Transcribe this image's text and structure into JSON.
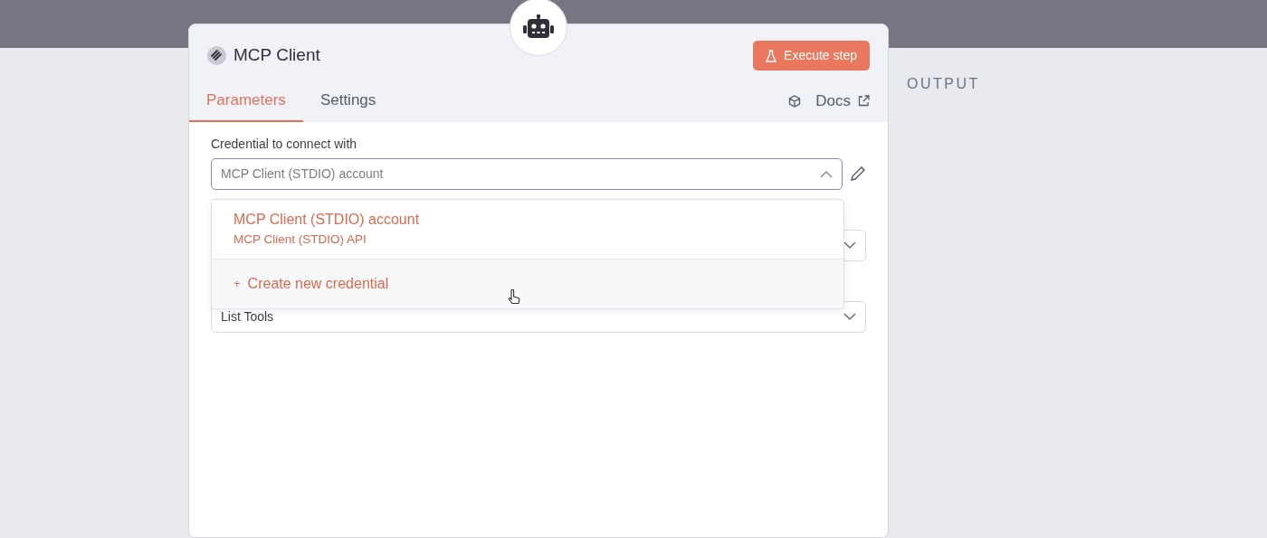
{
  "node": {
    "title": "MCP Client",
    "execute_button": "Execute step"
  },
  "tabs": [
    {
      "label": "Parameters",
      "selected": true
    },
    {
      "label": "Settings",
      "selected": false
    }
  ],
  "docs_link": "Docs",
  "credential": {
    "label": "Credential to connect with",
    "value": "MCP Client (STDIO) account",
    "expanded": true
  },
  "dropdown": {
    "options": [
      {
        "title": "MCP Client (STDIO) account",
        "subtitle": "MCP Client (STDIO) API",
        "selected": true
      }
    ],
    "create_action": {
      "icon": "+",
      "label": "Create new credential"
    }
  },
  "fields": [
    {
      "expanded": false
    },
    {
      "value": "List Tools",
      "expanded": false
    }
  ],
  "output": {
    "label": "OUTPUT"
  }
}
